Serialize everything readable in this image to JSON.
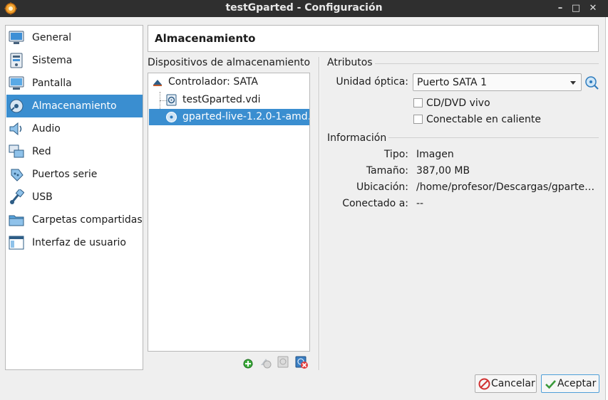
{
  "window": {
    "title": "testGparted - Configuración",
    "minimize": "–",
    "maximize": "□",
    "close": "✕"
  },
  "sidebar": {
    "items": [
      {
        "label": "General",
        "icon": "general-icon"
      },
      {
        "label": "Sistema",
        "icon": "system-icon"
      },
      {
        "label": "Pantalla",
        "icon": "display-icon"
      },
      {
        "label": "Almacenamiento",
        "icon": "storage-icon",
        "selected": true
      },
      {
        "label": "Audio",
        "icon": "audio-icon"
      },
      {
        "label": "Red",
        "icon": "network-icon"
      },
      {
        "label": "Puertos serie",
        "icon": "serial-ports-icon"
      },
      {
        "label": "USB",
        "icon": "usb-icon"
      },
      {
        "label": "Carpetas compartidas",
        "icon": "shared-folders-icon"
      },
      {
        "label": "Interfaz de usuario",
        "icon": "user-interface-icon"
      }
    ]
  },
  "header": {
    "title": "Almacenamiento"
  },
  "storage_tree": {
    "title": "Dispositivos de almacenamiento",
    "controller": "Controlador: SATA",
    "items": [
      {
        "label": "testGparted.vdi",
        "icon": "hard-disk-icon"
      },
      {
        "label": "gparted-live-1.2.0-1-amd…",
        "icon": "optical-disc-icon",
        "selected": true
      }
    ]
  },
  "attributes": {
    "title": "Atributos",
    "optical_drive_label": "Unidad óptica:",
    "optical_drive_value": "Puerto SATA 1",
    "live_cd_label": "CD/DVD vivo",
    "live_cd_checked": false,
    "hot_pluggable_label": "Conectable en caliente",
    "hot_pluggable_checked": false
  },
  "information": {
    "title": "Información",
    "type_label": "Tipo:",
    "type_value": "Imagen",
    "size_label": "Tamaño:",
    "size_value": "387,00 MB",
    "location_label": "Ubicación:",
    "location_value": "/home/profesor/Descargas/gparted…",
    "attached_label": "Conectado a:",
    "attached_value": "--"
  },
  "buttons": {
    "cancel": "Cancelar",
    "ok": "Aceptar"
  },
  "colors": {
    "selection": "#3a8ed0",
    "titlebar": "#2f2f2f"
  }
}
